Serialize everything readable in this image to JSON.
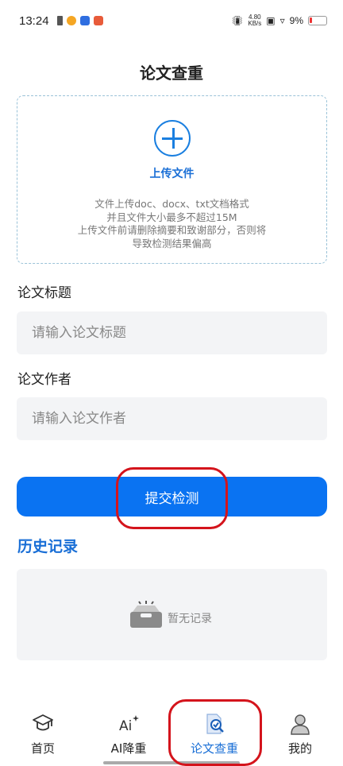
{
  "status_bar": {
    "time": "13:24",
    "net_speed_value": "4.80",
    "net_speed_unit": "KB/s",
    "battery": "9%"
  },
  "page": {
    "title": "论文查重"
  },
  "upload": {
    "label": "上传文件",
    "hint_lines": [
      "文件上传doc、docx、txt文档格式",
      "并且文件大小最多不超过15M",
      "上传文件前请删除摘要和致谢部分，否则将",
      "导致检测结果偏高"
    ]
  },
  "form": {
    "title_label": "论文标题",
    "title_placeholder": "请输入论文标题",
    "author_label": "论文作者",
    "author_placeholder": "请输入论文作者",
    "submit_label": "提交检测"
  },
  "history": {
    "title": "历史记录",
    "empty_text": "暂无记录"
  },
  "tabbar": {
    "tabs": [
      {
        "label": "首页",
        "icon": "graduation-cap-icon",
        "active": false
      },
      {
        "label": "AI降重",
        "icon": "ai-sparkle-icon",
        "active": false
      },
      {
        "label": "论文查重",
        "icon": "document-check-icon",
        "active": true
      },
      {
        "label": "我的",
        "icon": "user-avatar-icon",
        "active": false
      }
    ]
  },
  "colors": {
    "accent": "#0a73f2",
    "link_blue": "#1a6fd6",
    "input_bg": "#f3f4f6",
    "annotation_red": "#d4141c"
  }
}
